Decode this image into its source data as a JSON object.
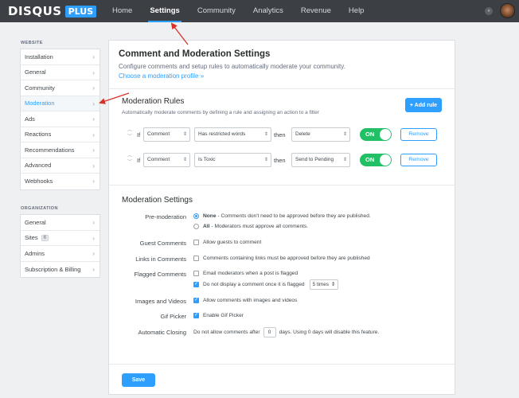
{
  "brand": {
    "name": "DISQUS",
    "badge": "PLUS"
  },
  "nav": [
    "Home",
    "Settings",
    "Community",
    "Analytics",
    "Revenue",
    "Help"
  ],
  "sidebar": {
    "website_label": "WEBSITE",
    "website_items": [
      "Installation",
      "General",
      "Community",
      "Moderation",
      "Ads",
      "Reactions",
      "Recommendations",
      "Advanced",
      "Webhooks"
    ],
    "organization_label": "ORGANIZATION",
    "org_items": {
      "general": "General",
      "sites": "Sites",
      "sites_count": "6",
      "admins": "Admins",
      "billing": "Subscription & Billing"
    }
  },
  "header": {
    "title": "Comment and Moderation Settings",
    "description": "Configure comments and setup rules to automatically moderate your community.",
    "profile_link": "Choose a moderation profile »"
  },
  "rules": {
    "title": "Moderation Rules",
    "subtitle": "Automatically moderate comments by defining a rule and assigning an action to a filter",
    "add_button": "+ Add rule",
    "if_label": "If",
    "then_label": "then",
    "toggle_label": "ON",
    "remove_label": "Remove",
    "rows": [
      {
        "subject": "Comment",
        "condition": "Has restricted words",
        "action": "Delete"
      },
      {
        "subject": "Comment",
        "condition": "Is Toxic",
        "action": "Send to Pending"
      }
    ]
  },
  "settings": {
    "title": "Moderation Settings",
    "premoderation": {
      "label": "Pre-moderation",
      "none_bold": "None",
      "none_text": "- Comments don't need to be approved before they are published.",
      "all_bold": "All",
      "all_text": "- Moderators must approve all comments."
    },
    "guest": {
      "label": "Guest Comments",
      "option": "Allow guests to comment"
    },
    "links": {
      "label": "Links in Comments",
      "option": "Comments containing links must be approved before they are published"
    },
    "flagged": {
      "label": "Flagged Comments",
      "email_option": "Email moderators when a post is flagged",
      "hide_option": "Do not display a comment once it is flagged",
      "times_value": "5 times"
    },
    "images": {
      "label": "Images and Videos",
      "option": "Allow comments with images and videos"
    },
    "gif": {
      "label": "Gif Picker",
      "option": "Enable Gif Picker"
    },
    "closing": {
      "label": "Automatic Closing",
      "before": "Do not allow comments after",
      "value": "0",
      "after": "days. Using 0 days will disable this feature."
    }
  },
  "save_label": "Save",
  "colors": {
    "accent": "#2e9fff",
    "toggle_on": "#22c064",
    "topbar": "#3c4045",
    "annotation_arrow": "#d93025"
  }
}
